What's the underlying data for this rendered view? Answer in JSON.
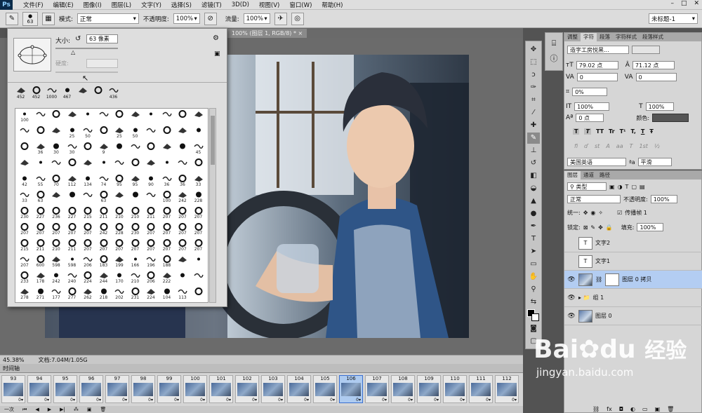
{
  "app": {
    "logo": "Ps",
    "menus": [
      "文件(F)",
      "编辑(E)",
      "图像(I)",
      "图层(L)",
      "文字(Y)",
      "选择(S)",
      "滤镜(T)",
      "3D(D)",
      "视图(V)",
      "窗口(W)",
      "帮助(H)"
    ]
  },
  "options": {
    "brush_size": "63",
    "mode_label": "模式:",
    "mode_value": "正常",
    "opacity_label": "不透明度:",
    "opacity_value": "100%",
    "flow_label": "流量:",
    "flow_value": "100%",
    "workspace": "未标题-1"
  },
  "document": {
    "tab_title": "100% (图层 1, RGB/8) *",
    "zoom": "45.38%",
    "doc_info": "文档:7.04M/1.05G"
  },
  "brush_panel": {
    "size_label": "大小:",
    "size_value": "63 像素",
    "hardness_label": "硬度:",
    "recent": [
      "452",
      "452",
      "1000",
      "467",
      "",
      "",
      "436"
    ],
    "grid": [
      [
        "100",
        "",
        "",
        "",
        "",
        "",
        "",
        "",
        "",
        "",
        "",
        ""
      ],
      [
        "",
        "",
        "",
        "25",
        "50",
        "",
        "25",
        "50",
        "",
        "",
        "",
        ""
      ],
      [
        "",
        "36",
        "30",
        "30",
        "",
        "9",
        "",
        "",
        "",
        "",
        "",
        "45"
      ],
      [
        "",
        "",
        "",
        "",
        "",
        "",
        "",
        "",
        "",
        "",
        "",
        ""
      ],
      [
        "42",
        "55",
        "70",
        "112",
        "134",
        "74",
        "95",
        "95",
        "90",
        "36",
        "36",
        "33"
      ],
      [
        "33",
        "63",
        "",
        "",
        "",
        "63",
        "",
        "",
        "",
        "100",
        "242",
        "228"
      ],
      [
        "230",
        "227",
        "236",
        "227",
        "215",
        "211",
        "210",
        "210",
        "211",
        "207",
        "207",
        "207"
      ],
      [
        "207",
        "207",
        "207",
        "207",
        "207",
        "242",
        "228",
        "230",
        "207",
        "207",
        "207",
        "207"
      ],
      [
        "215",
        "211",
        "210",
        "211",
        "207",
        "207",
        "207",
        "207",
        "207",
        "207",
        "207",
        "207"
      ],
      [
        "207",
        "600",
        "598",
        "598",
        "206",
        "183",
        "199",
        "166",
        "196",
        "188",
        "",
        ""
      ],
      [
        "233",
        "178",
        "242",
        "240",
        "224",
        "244",
        "170",
        "210",
        "206",
        "222",
        "",
        ""
      ],
      [
        "278",
        "271",
        "177",
        "277",
        "262",
        "218",
        "202",
        "231",
        "224",
        "104",
        "113",
        ""
      ]
    ]
  },
  "timeline": {
    "header": "时间轴",
    "frames": [
      "93",
      "94",
      "95",
      "96",
      "97",
      "98",
      "99",
      "100",
      "101",
      "102",
      "103",
      "104",
      "105",
      "106",
      "107",
      "108",
      "109",
      "110",
      "111",
      "112"
    ],
    "selected_frame": "106",
    "delay": "0",
    "loop": "一次"
  },
  "character_panel": {
    "tabs": [
      "调整",
      "字符",
      "段落",
      "字符样式",
      "段落样式"
    ],
    "active_tab": "字符",
    "font_family": "造字工房悦黑...",
    "font_size": "79.02 点",
    "leading": "71.12 点",
    "kerning": "0",
    "tracking": "0",
    "scale_pct": "0%",
    "vscale": "100%",
    "hscale": "100%",
    "baseline": "0 点",
    "color_label": "颜色:",
    "style_buttons": [
      "T",
      "T",
      "TT",
      "Tr",
      "T¹",
      "T,",
      "T",
      "Ŧ"
    ],
    "ot_buttons": [
      "fi",
      "ɗ",
      "st",
      "A",
      "aa",
      "T",
      "1st",
      "½"
    ],
    "language": "美国英语",
    "aa_label": "ªa",
    "antialias": "平滑"
  },
  "layers_panel": {
    "tabs": [
      "图层",
      "通道",
      "路径"
    ],
    "filter_label": "类型",
    "blend_mode": "正常",
    "opacity_label": "不透明度:",
    "opacity_value": "100%",
    "unify_label": "统一:",
    "propagate_label": "传播帧 1",
    "lock_label": "锁定:",
    "fill_label": "填充:",
    "fill_value": "100%",
    "layers": [
      {
        "name": "文字2",
        "type": "text",
        "visible": false
      },
      {
        "name": "文字1",
        "type": "text",
        "visible": false
      },
      {
        "name": "图层 0 拷贝",
        "type": "image-mask",
        "visible": true,
        "selected": true
      },
      {
        "name": "组 1",
        "type": "group",
        "visible": true
      },
      {
        "name": "图层 0",
        "type": "image",
        "visible": true
      }
    ]
  },
  "watermark": {
    "brand": "Bai",
    "brand2": "du",
    "cn": "经验",
    "url": "jingyan.baidu.com"
  }
}
